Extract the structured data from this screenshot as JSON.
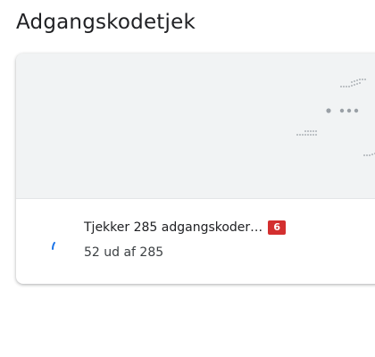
{
  "page": {
    "title": "Adgangskodetjek"
  },
  "check": {
    "status_title": "Tjekker 285 adgangskoder…",
    "status_progress": "52 ud af 285",
    "progress": {
      "done": 52,
      "total": 285
    },
    "badge": "6"
  },
  "icons": {
    "spinner": "spinner-icon",
    "illustration": "password-dots-illustration"
  },
  "colors": {
    "accent": "#1a73e8",
    "badge": "#d32f2f",
    "illustration_bg": "#f1f3f4",
    "dots": "#9aa0a6"
  }
}
